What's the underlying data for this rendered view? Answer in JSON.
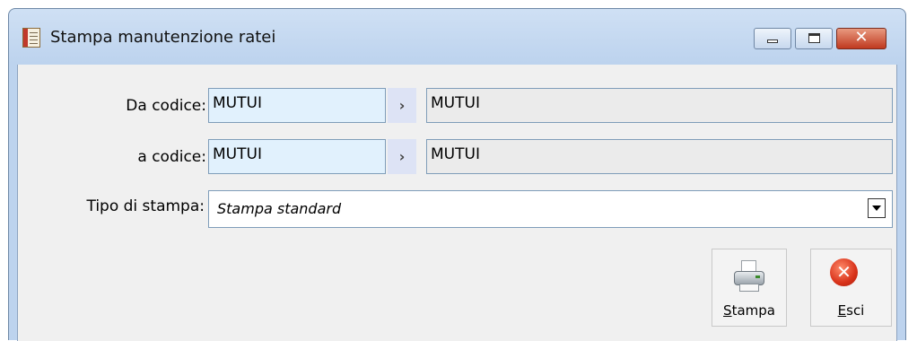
{
  "window": {
    "title": "Stampa manutenzione ratei"
  },
  "form": {
    "da_codice": {
      "label": "Da codice:",
      "value": "MUTUI",
      "description": "MUTUI"
    },
    "a_codice": {
      "label": "a codice:",
      "value": "MUTUI",
      "description": "MUTUI"
    },
    "tipo_stampa": {
      "label": "Tipo di stampa:",
      "value": "Stampa standard"
    },
    "zoom_glyph": "›"
  },
  "buttons": {
    "stampa": {
      "label_underlined": "S",
      "label_rest": "tampa",
      "icon": "printer-icon"
    },
    "esci": {
      "label_underlined": "E",
      "label_rest": "sci",
      "icon": "close-circle-icon"
    }
  },
  "colors": {
    "edit_field_bg": "#e1f1fd",
    "readonly_field_bg": "#ebebeb",
    "zoom_bg": "#dde3f5"
  }
}
